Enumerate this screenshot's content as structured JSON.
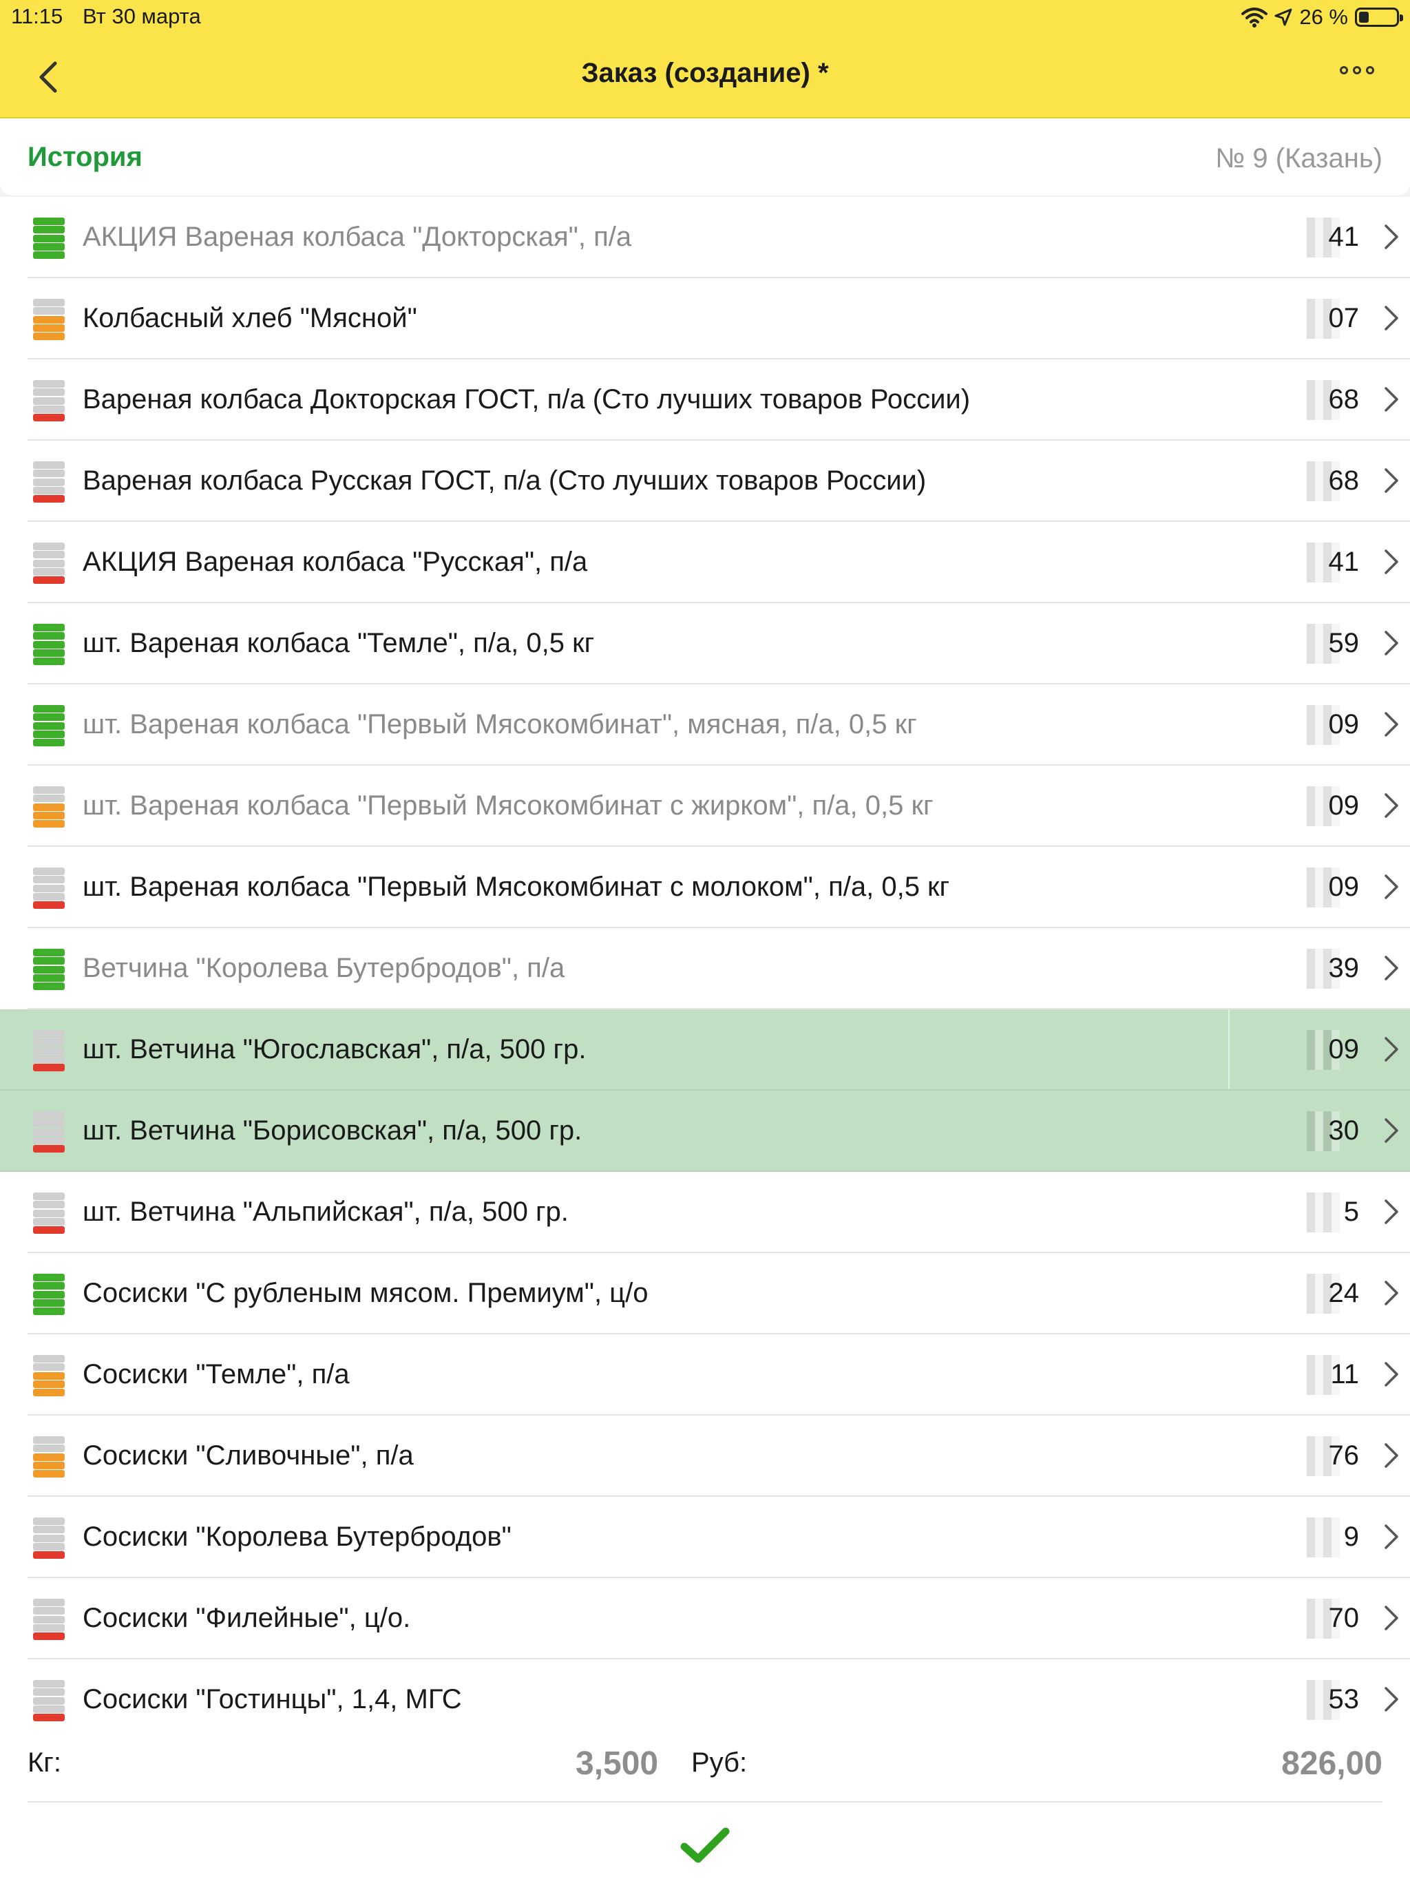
{
  "status": {
    "time": "11:15",
    "date": "Вт 30 марта",
    "battery": "26 %",
    "battery_level": 0.26
  },
  "nav": {
    "title": "Заказ (создание) *"
  },
  "header": {
    "history": "История",
    "order_number": "№ 9 (Казань)"
  },
  "colors": {
    "green": "#3fae2a",
    "orange": "#f09a2a",
    "red": "#e23b2e",
    "gray": "#cfcfcf",
    "accent": "#1f9a3b",
    "topbar": "#fbe44a"
  },
  "items": [
    {
      "label": "АКЦИЯ Вареная колбаса \"Докторская\", п/а",
      "value": "41",
      "status": "green",
      "muted": true,
      "selected": false
    },
    {
      "label": "Колбасный хлеб \"Мясной\"",
      "value": "07",
      "status": "orange",
      "muted": false,
      "selected": false
    },
    {
      "label": "Вареная колбаса Докторская ГОСТ, п/а (Сто лучших товаров России)",
      "value": "68",
      "status": "red",
      "muted": false,
      "selected": false
    },
    {
      "label": "Вареная колбаса Русская ГОСТ, п/а (Сто лучших товаров России)",
      "value": "68",
      "status": "red",
      "muted": false,
      "selected": false
    },
    {
      "label": "АКЦИЯ Вареная колбаса \"Русская\", п/а",
      "value": "41",
      "status": "red",
      "muted": false,
      "selected": false
    },
    {
      "label": "шт. Вареная колбаса \"Темле\", п/а, 0,5 кг",
      "value": "59",
      "status": "green",
      "muted": false,
      "selected": false
    },
    {
      "label": "шт. Вареная колбаса \"Первый Мясокомбинат\", мясная, п/а, 0,5 кг",
      "value": "09",
      "status": "green",
      "muted": true,
      "selected": false
    },
    {
      "label": "шт. Вареная колбаса \"Первый Мясокомбинат с жирком\", п/а, 0,5 кг",
      "value": "09",
      "status": "orange",
      "muted": true,
      "selected": false
    },
    {
      "label": "шт. Вареная колбаса \"Первый Мясокомбинат с молоком\", п/а, 0,5 кг",
      "value": "09",
      "status": "red",
      "muted": false,
      "selected": false
    },
    {
      "label": "Ветчина \"Королева Бутербродов\", п/а",
      "value": "39",
      "status": "green",
      "muted": true,
      "selected": false
    },
    {
      "label": "шт. Ветчина \"Югославская\", п/а, 500 гр.",
      "value": "09",
      "status": "red",
      "muted": false,
      "selected": true
    },
    {
      "label": "шт. Ветчина \"Борисовская\", п/а, 500 гр.",
      "value": "30",
      "status": "red",
      "muted": false,
      "selected": true
    },
    {
      "label": "шт. Ветчина \"Альпийская\", п/а, 500 гр.",
      "value": "5",
      "status": "red",
      "muted": false,
      "selected": false
    },
    {
      "label": "Сосиски \"С рубленым мясом. Премиум\", ц/о",
      "value": "24",
      "status": "green",
      "muted": false,
      "selected": false
    },
    {
      "label": "Сосиски \"Темле\", п/а",
      "value": "11",
      "status": "orange",
      "muted": false,
      "selected": false
    },
    {
      "label": "Сосиски \"Сливочные\", п/а",
      "value": "76",
      "status": "orange",
      "muted": false,
      "selected": false
    },
    {
      "label": "Сосиски \"Королева Бутербродов\"",
      "value": "9",
      "status": "red",
      "muted": false,
      "selected": false
    },
    {
      "label": "Сосиски \"Филейные\", ц/о.",
      "value": "70",
      "status": "red",
      "muted": false,
      "selected": false
    },
    {
      "label": "Сосиски \"Гостинцы\", 1,4, МГС",
      "value": "53",
      "status": "red",
      "muted": false,
      "selected": false
    }
  ],
  "footer": {
    "kg_label": "Кг:",
    "kg_value": "3,500",
    "rub_label": "Руб:",
    "rub_value": "826,00"
  },
  "icons": {
    "back": "chevron-left-icon",
    "more": "more-dots-icon",
    "row": "chevron-right-icon",
    "confirm": "checkmark-icon"
  }
}
